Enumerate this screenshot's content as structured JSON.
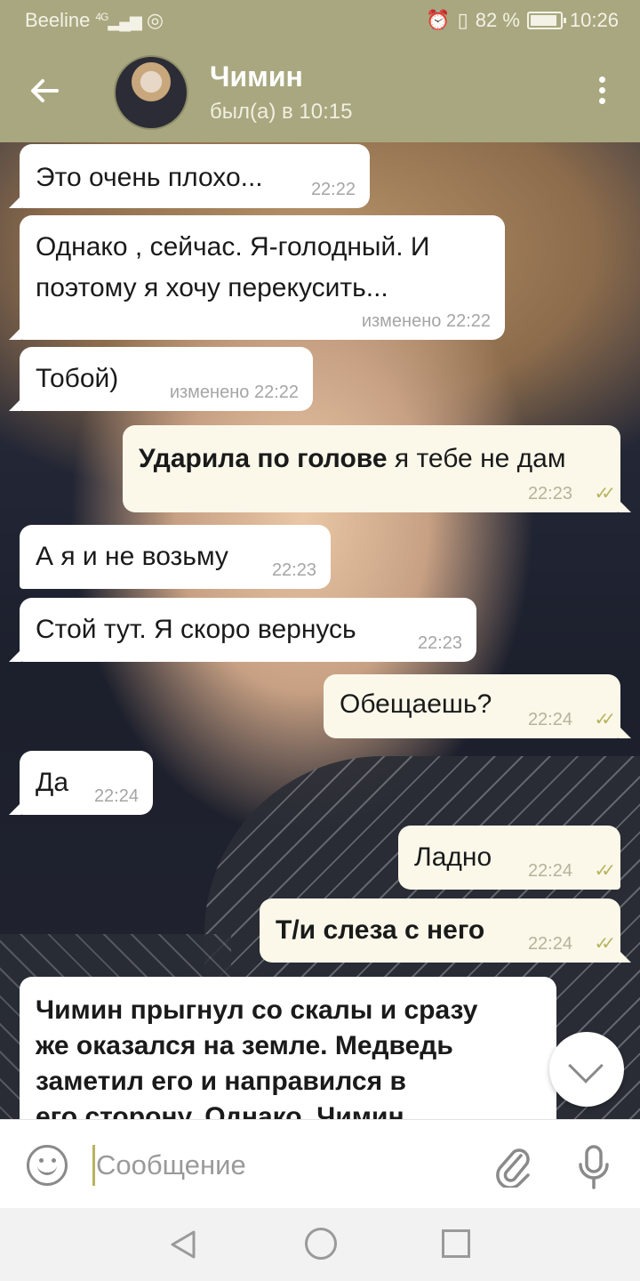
{
  "status_bar": {
    "carrier": "Beeline",
    "network": "4G",
    "battery": "82 %",
    "time": "10:26"
  },
  "header": {
    "contact_name": "Чимин",
    "last_seen": "был(а) в 10:15"
  },
  "messages": [
    {
      "dir": "in",
      "text": "Это очень плохо...",
      "time": "22:22"
    },
    {
      "dir": "in",
      "text_line1": "Однако , сейчас. Я-голодный. И",
      "text_line2": "поэтому я хочу перекусить...",
      "time": "изменено 22:22"
    },
    {
      "dir": "in",
      "text": "Тобой)",
      "time": "изменено 22:22"
    },
    {
      "dir": "out",
      "bold": "Ударила по голове",
      "text": " я тебе не дам",
      "time": "22:23",
      "read": true
    },
    {
      "dir": "in",
      "text": "А я и не возьму",
      "time": "22:23"
    },
    {
      "dir": "in",
      "text": "Стой тут. Я скоро вернусь",
      "time": "22:23"
    },
    {
      "dir": "out",
      "text": "Обещаешь?",
      "time": "22:24",
      "read": true
    },
    {
      "dir": "in",
      "text": "Да",
      "time": "22:24"
    },
    {
      "dir": "out",
      "text": "Ладно",
      "time": "22:24",
      "read": true
    },
    {
      "dir": "out",
      "text": "Т/и слеза с него",
      "time": "22:24",
      "read": true
    },
    {
      "dir": "in",
      "line1": "Чимин прыгнул со скалы и сразу",
      "line2": "же оказался на земле. Медведь",
      "line3": "заметил его и направился в",
      "line4": "его сторону. Однако, Чимин"
    }
  ],
  "composer": {
    "placeholder": "Сообщение"
  },
  "icons": {
    "back": "arrow-left-icon",
    "menu": "more-vert-icon",
    "emoji": "smiley-icon",
    "attach": "paperclip-icon",
    "mic": "microphone-icon",
    "scroll": "chevron-down-icon"
  },
  "colors": {
    "header": "#a8a77f",
    "outgoing_bubble": "#fbf8ea",
    "incoming_bubble": "#ffffff",
    "read_check": "#b8b35c"
  }
}
